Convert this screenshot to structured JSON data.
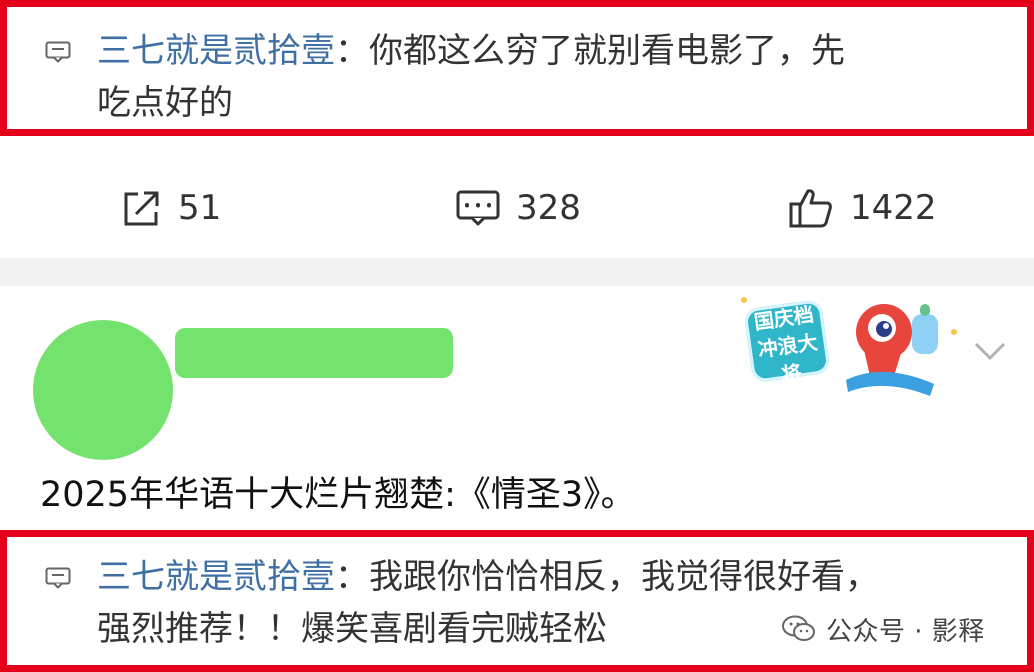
{
  "top_comment": {
    "author": "三七就是贰拾壹",
    "separator": "：",
    "text_line1": "你都这么穷了就别看电影了，先",
    "text_line2": "吃点好的"
  },
  "stats": {
    "share_count": "51",
    "comment_count": "328",
    "like_count": "1422"
  },
  "post": {
    "text": "2025年华语十大烂片翘楚:《情圣3》。"
  },
  "badge": {
    "line1": "国庆档",
    "line2": "冲浪大将"
  },
  "bottom_comment": {
    "author": "三七就是贰拾壹",
    "separator": "：",
    "text_line1": "我跟你恰恰相反，我觉得很好看，",
    "text_line2": "强烈推荐！！爆笑喜剧看完贼轻松"
  },
  "watermark": {
    "text": "公众号 · 影释"
  },
  "colors": {
    "highlight_border": "#e2001a",
    "author": "#3f6fa3",
    "placeholder_green": "#74e36d"
  }
}
